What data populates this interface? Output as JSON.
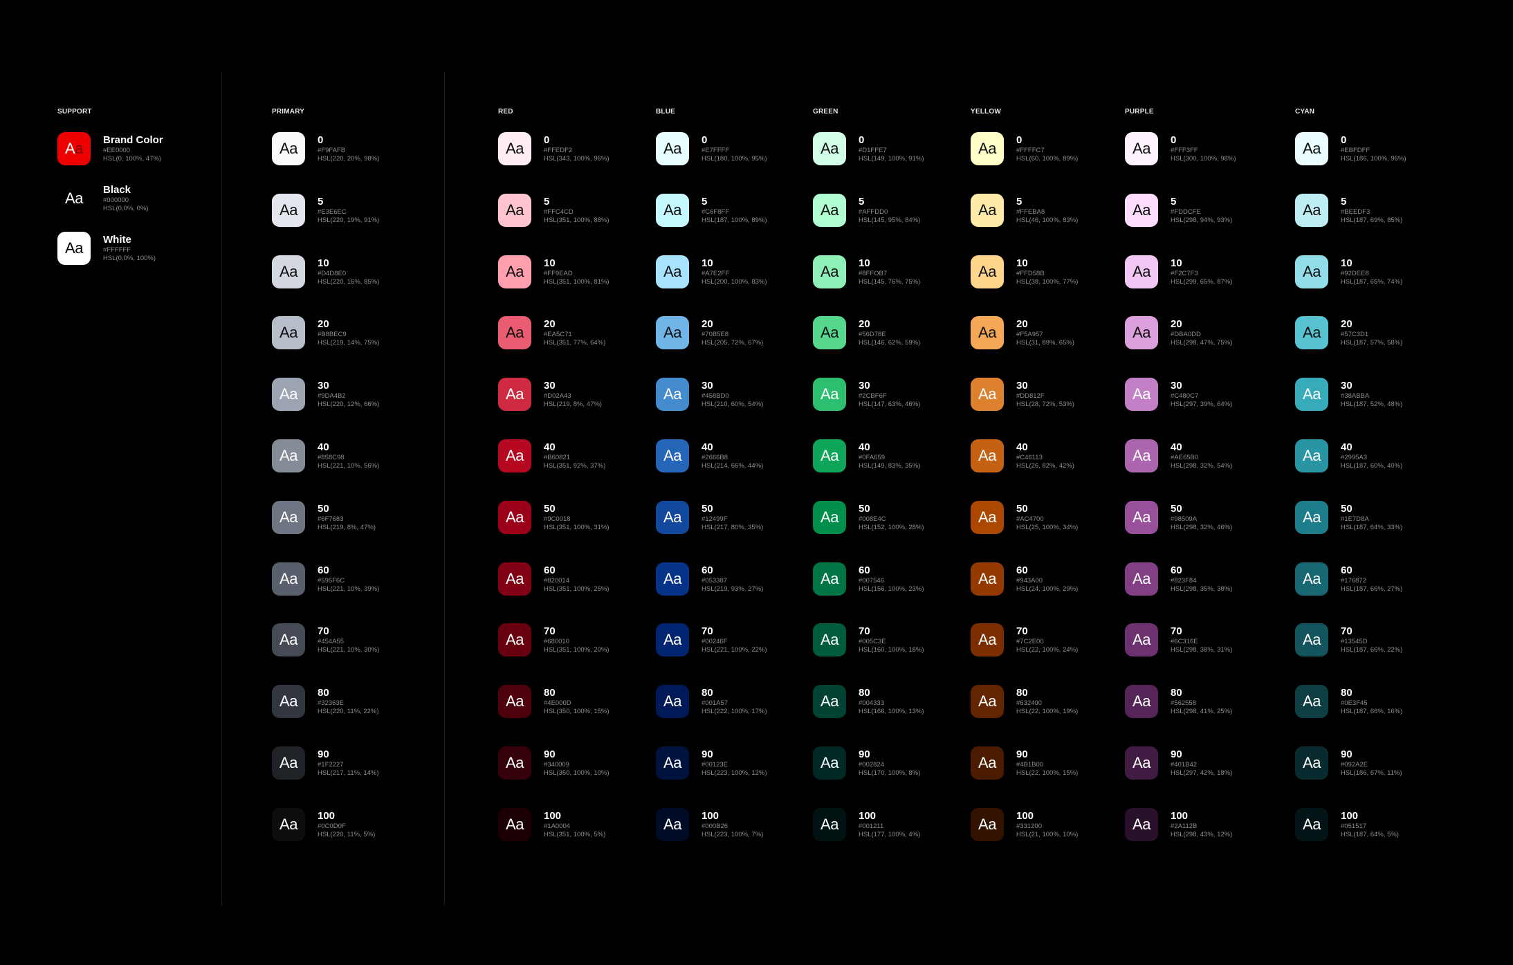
{
  "support": {
    "title": "SUPPORT",
    "items": [
      {
        "name": "Brand Color",
        "hex": "#EE0000",
        "hsl": "HSL(0, 100%, 47%)",
        "bg": "#EE0000",
        "fg": "#FFFFFF",
        "sample": "Aa"
      },
      {
        "name": "Black",
        "hex": "#000000",
        "hsl": "HSL(0,0%, 0%)",
        "bg": "#000000",
        "fg": "#FFFFFF",
        "sample": "Aa"
      },
      {
        "name": "White",
        "hex": "#FFFFFF",
        "hsl": "HSL(0,0%, 100%)",
        "bg": "#FFFFFF",
        "fg": "#000000",
        "sample": "Aa"
      }
    ]
  },
  "palettes": [
    {
      "title": "PRIMARY",
      "swatches": [
        {
          "level": "0",
          "hex": "#F9FAFB",
          "hsl": "HSL(220, 20%, 98%)"
        },
        {
          "level": "5",
          "hex": "#E3E6EC",
          "hsl": "HSL(220, 19%, 91%)"
        },
        {
          "level": "10",
          "hex": "#D4D8E0",
          "hsl": "HSL(220, 16%, 85%)"
        },
        {
          "level": "20",
          "hex": "#B8BEC9",
          "hsl": "HSL(219, 14%, 75%)"
        },
        {
          "level": "30",
          "hex": "#9DA4B2",
          "hsl": "HSL(220, 12%, 66%)"
        },
        {
          "level": "40",
          "hex": "#858C98",
          "hsl": "HSL(221, 10%, 56%)"
        },
        {
          "level": "50",
          "hex": "#6F7683",
          "hsl": "HSL(219, 8%, 47%)"
        },
        {
          "level": "60",
          "hex": "#595F6C",
          "hsl": "HSL(221, 10%, 39%)"
        },
        {
          "level": "70",
          "hex": "#454A55",
          "hsl": "HSL(221, 10%, 30%)"
        },
        {
          "level": "80",
          "hex": "#32363E",
          "hsl": "HSL(220, 11%, 22%)"
        },
        {
          "level": "90",
          "hex": "#1F2227",
          "hsl": "HSL(217, 11%, 14%)"
        },
        {
          "level": "100",
          "hex": "#0C0D0F",
          "hsl": "HSL(220, 11%, 5%)"
        }
      ]
    },
    {
      "title": "RED",
      "swatches": [
        {
          "level": "0",
          "hex": "#FFEDF2",
          "hsl": "HSL(343, 100%, 96%)"
        },
        {
          "level": "5",
          "hex": "#FFC4CD",
          "hsl": "HSL(351, 100%, 88%)"
        },
        {
          "level": "10",
          "hex": "#FF9EAD",
          "hsl": "HSL(351, 100%, 81%)"
        },
        {
          "level": "20",
          "hex": "#EA5C71",
          "hsl": "HSL(351, 77%, 64%)"
        },
        {
          "level": "30",
          "hex": "#D02A43",
          "hsl": "HSL(219, 8%, 47%)"
        },
        {
          "level": "40",
          "hex": "#B60821",
          "hsl": "HSL(351, 92%, 37%)"
        },
        {
          "level": "50",
          "hex": "#9C0018",
          "hsl": "HSL(351, 100%, 31%)"
        },
        {
          "level": "60",
          "hex": "#820014",
          "hsl": "HSL(351, 100%, 25%)"
        },
        {
          "level": "70",
          "hex": "#680010",
          "hsl": "HSL(351, 100%, 20%)"
        },
        {
          "level": "80",
          "hex": "#4E000D",
          "hsl": "HSL(350, 100%, 15%)"
        },
        {
          "level": "90",
          "hex": "#340009",
          "hsl": "HSL(350, 100%, 10%)"
        },
        {
          "level": "100",
          "hex": "#1A0004",
          "hsl": "HSL(351, 100%, 5%)"
        }
      ]
    },
    {
      "title": "BLUE",
      "swatches": [
        {
          "level": "0",
          "hex": "#E7FFFF",
          "hsl": "HSL(180, 100%, 95%)"
        },
        {
          "level": "5",
          "hex": "#C6F8FF",
          "hsl": "HSL(187, 100%, 89%)"
        },
        {
          "level": "10",
          "hex": "#A7E2FF",
          "hsl": "HSL(200, 100%, 83%)"
        },
        {
          "level": "20",
          "hex": "#70B5E8",
          "hsl": "HSL(205, 72%, 67%)"
        },
        {
          "level": "30",
          "hex": "#458BD0",
          "hsl": "HSL(210, 60%, 54%)"
        },
        {
          "level": "40",
          "hex": "#2666B8",
          "hsl": "HSL(214, 66%, 44%)"
        },
        {
          "level": "50",
          "hex": "#12499F",
          "hsl": "HSL(217, 80%, 35%)"
        },
        {
          "level": "60",
          "hex": "#053387",
          "hsl": "HSL(219, 93%, 27%)"
        },
        {
          "level": "70",
          "hex": "#00246F",
          "hsl": "HSL(221, 100%, 22%)"
        },
        {
          "level": "80",
          "hex": "#001A57",
          "hsl": "HSL(222, 100%, 17%)"
        },
        {
          "level": "90",
          "hex": "#00123E",
          "hsl": "HSL(223, 100%, 12%)"
        },
        {
          "level": "100",
          "hex": "#000B26",
          "hsl": "HSL(223, 100%, 7%)"
        }
      ]
    },
    {
      "title": "GREEN",
      "swatches": [
        {
          "level": "0",
          "hex": "#D1FFE7",
          "hsl": "HSL(149, 100%, 91%)"
        },
        {
          "level": "5",
          "hex": "#AFFDD0",
          "hsl": "HSL(145, 95%, 84%)"
        },
        {
          "level": "10",
          "hex": "#8FFOB7",
          "hsl": "HSL(145, 76%, 75%)"
        },
        {
          "level": "20",
          "hex": "#56D78E",
          "hsl": "HSL(146, 62%, 59%)"
        },
        {
          "level": "30",
          "hex": "#2CBF6F",
          "hsl": "HSL(147, 63%, 46%)"
        },
        {
          "level": "40",
          "hex": "#0FA659",
          "hsl": "HSL(149, 83%, 35%)"
        },
        {
          "level": "50",
          "hex": "#008E4C",
          "hsl": "HSL(152, 100%, 28%)"
        },
        {
          "level": "60",
          "hex": "#007546",
          "hsl": "HSL(156, 100%, 23%)"
        },
        {
          "level": "70",
          "hex": "#005C3E",
          "hsl": "HSL(160, 100%, 18%)"
        },
        {
          "level": "80",
          "hex": "#004333",
          "hsl": "HSL(166, 100%, 13%)"
        },
        {
          "level": "90",
          "hex": "#002824",
          "hsl": "HSL(170, 100%, 8%)"
        },
        {
          "level": "100",
          "hex": "#001211",
          "hsl": "HSL(177, 100%, 4%)"
        }
      ]
    },
    {
      "title": "YELLOW",
      "swatches": [
        {
          "level": "0",
          "hex": "#FFFFC7",
          "hsl": "HSL(60, 100%, 89%)"
        },
        {
          "level": "5",
          "hex": "#FFEBA8",
          "hsl": "HSL(46, 100%, 83%)"
        },
        {
          "level": "10",
          "hex": "#FFD58B",
          "hsl": "HSL(38, 100%, 77%)"
        },
        {
          "level": "20",
          "hex": "#F5A957",
          "hsl": "HSL(31, 89%, 65%)"
        },
        {
          "level": "30",
          "hex": "#DD812F",
          "hsl": "HSL(28, 72%, 53%)"
        },
        {
          "level": "40",
          "hex": "#C46113",
          "hsl": "HSL(26, 82%, 42%)"
        },
        {
          "level": "50",
          "hex": "#AC4700",
          "hsl": "HSL(25, 100%, 34%)"
        },
        {
          "level": "60",
          "hex": "#943A00",
          "hsl": "HSL(24, 100%, 29%)"
        },
        {
          "level": "70",
          "hex": "#7C2E00",
          "hsl": "HSL(22, 100%, 24%)"
        },
        {
          "level": "80",
          "hex": "#632400",
          "hsl": "HSL(22, 100%, 19%)"
        },
        {
          "level": "90",
          "hex": "#4B1B00",
          "hsl": "HSL(22, 100%, 15%)"
        },
        {
          "level": "100",
          "hex": "#331200",
          "hsl": "HSL(21, 100%, 10%)"
        }
      ]
    },
    {
      "title": "PURPLE",
      "swatches": [
        {
          "level": "0",
          "hex": "#FFF3FF",
          "hsl": "HSL(300, 100%, 98%)"
        },
        {
          "level": "5",
          "hex": "#FDDCFE",
          "hsl": "HSL(298, 94%, 93%)"
        },
        {
          "level": "10",
          "hex": "#F2C7F3",
          "hsl": "HSL(299, 65%, 87%)"
        },
        {
          "level": "20",
          "hex": "#DBA0DD",
          "hsl": "HSL(298, 47%, 75%)"
        },
        {
          "level": "30",
          "hex": "#C480C7",
          "hsl": "HSL(297, 39%, 64%)"
        },
        {
          "level": "40",
          "hex": "#AE65B0",
          "hsl": "HSL(298, 32%, 54%)"
        },
        {
          "level": "50",
          "hex": "#98509A",
          "hsl": "HSL(298, 32%, 46%)"
        },
        {
          "level": "60",
          "hex": "#823F84",
          "hsl": "HSL(298, 35%, 38%)"
        },
        {
          "level": "70",
          "hex": "#6C316E",
          "hsl": "HSL(298, 38%, 31%)"
        },
        {
          "level": "80",
          "hex": "#562558",
          "hsl": "HSL(298, 41%, 25%)"
        },
        {
          "level": "90",
          "hex": "#401B42",
          "hsl": "HSL(297, 42%, 18%)"
        },
        {
          "level": "100",
          "hex": "#2A112B",
          "hsl": "HSL(298, 43%, 12%)"
        }
      ]
    },
    {
      "title": "CYAN",
      "swatches": [
        {
          "level": "0",
          "hex": "#EBFDFF",
          "hsl": "HSL(186, 100%, 96%)"
        },
        {
          "level": "5",
          "hex": "#BEEDF3",
          "hsl": "HSL(187, 69%, 85%)"
        },
        {
          "level": "10",
          "hex": "#92DEE8",
          "hsl": "HSL(187, 65%, 74%)"
        },
        {
          "level": "20",
          "hex": "#57C3D1",
          "hsl": "HSL(187, 57%, 58%)"
        },
        {
          "level": "30",
          "hex": "#38ABBA",
          "hsl": "HSL(187, 52%, 48%)"
        },
        {
          "level": "40",
          "hex": "#2995A3",
          "hsl": "HSL(187, 60%, 40%)"
        },
        {
          "level": "50",
          "hex": "#1E7D8A",
          "hsl": "HSL(187, 64%, 33%)"
        },
        {
          "level": "60",
          "hex": "#176872",
          "hsl": "HSL(187, 66%, 27%)"
        },
        {
          "level": "70",
          "hex": "#13545D",
          "hsl": "HSL(187, 66%, 22%)"
        },
        {
          "level": "80",
          "hex": "#0E3F45",
          "hsl": "HSL(187, 66%, 16%)"
        },
        {
          "level": "90",
          "hex": "#092A2E",
          "hsl": "HSL(186, 67%, 11%)"
        },
        {
          "level": "100",
          "hex": "#051517",
          "hsl": "HSL(187, 64%, 5%)"
        }
      ]
    }
  ],
  "chip_sample": "Aa"
}
